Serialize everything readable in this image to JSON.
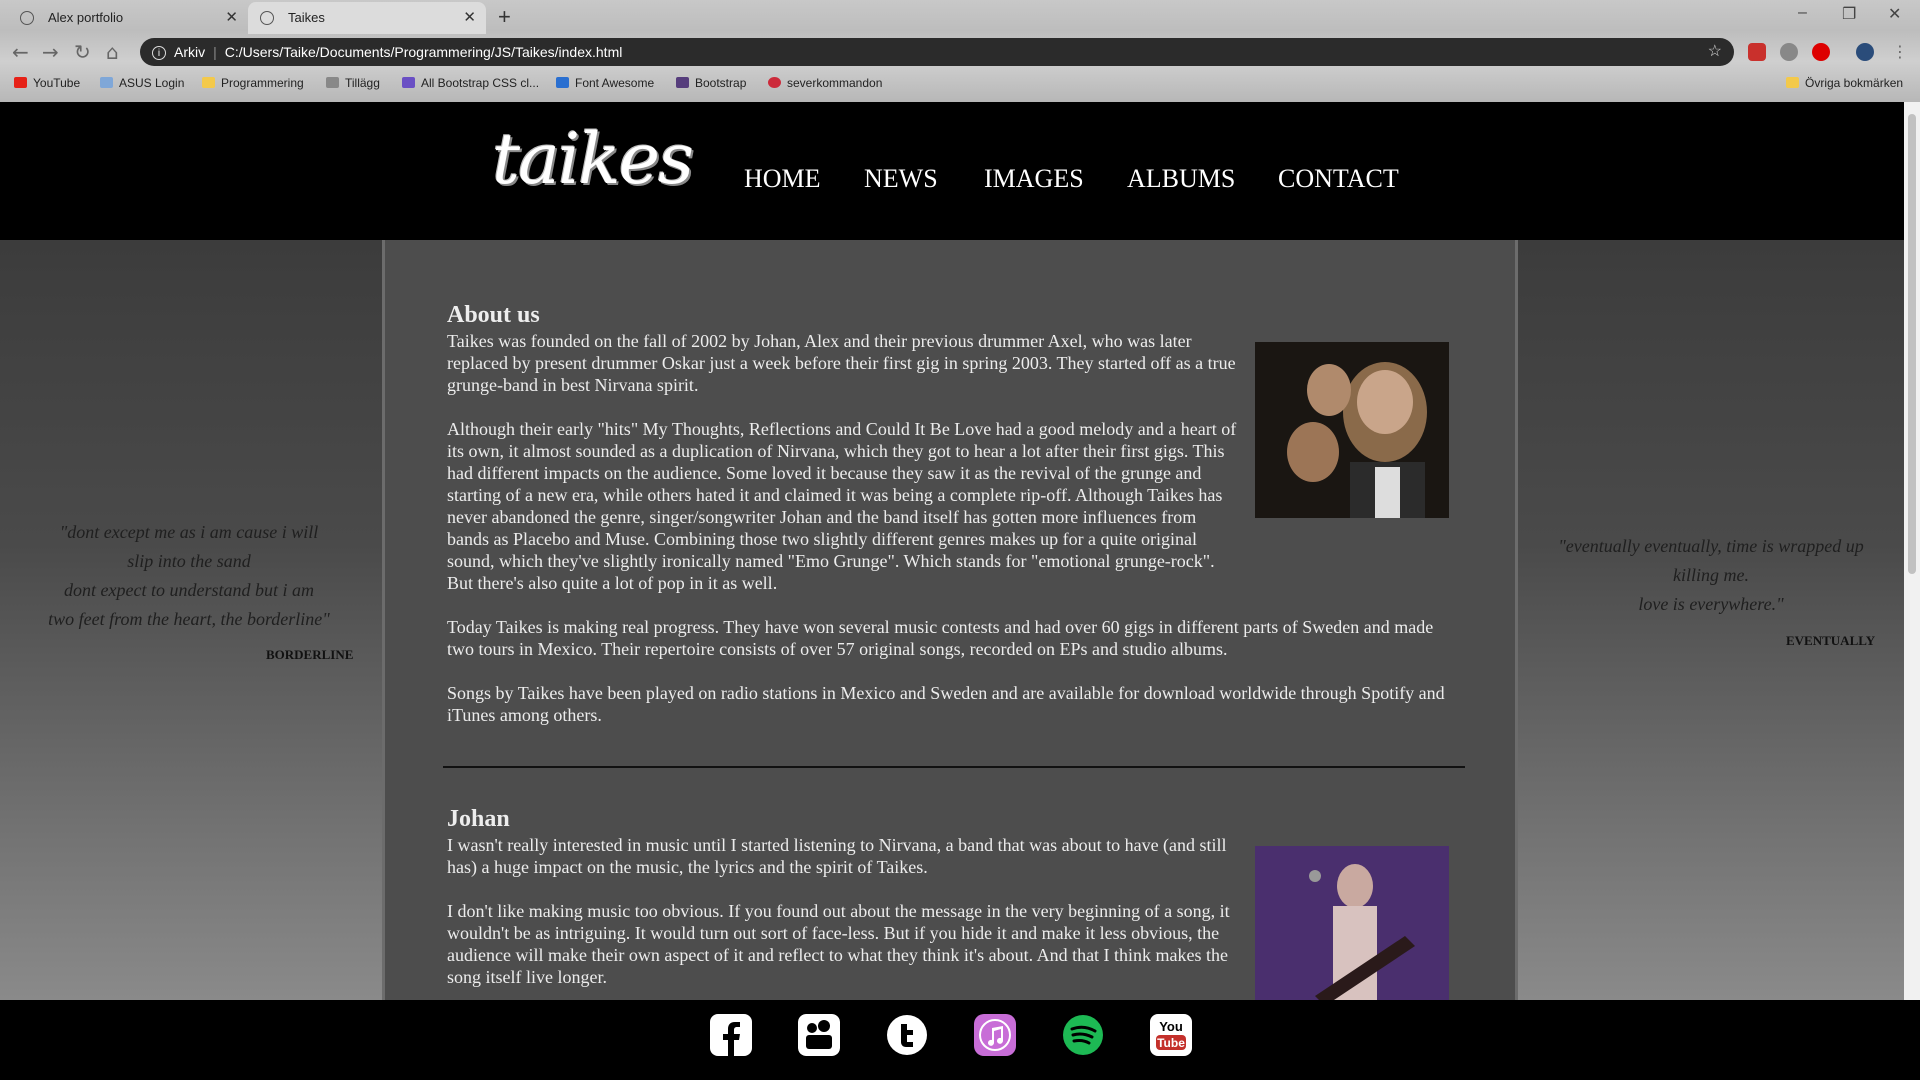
{
  "browser": {
    "tabs": [
      {
        "label": "Alex portfolio"
      },
      {
        "label": "Taikes"
      }
    ],
    "address": {
      "scheme": "Arkiv",
      "url": "C:/Users/Taike/Documents/Programmering/JS/Taikes/index.html"
    },
    "bookmarks": [
      {
        "label": "YouTube",
        "color": "#e62117"
      },
      {
        "label": "ASUS Login",
        "color": "#7fa7d8"
      },
      {
        "label": "Programmering",
        "color": "#f3c94b"
      },
      {
        "label": "Tillägg",
        "color": "#888888"
      },
      {
        "label": "All Bootstrap CSS cl...",
        "color": "#6a4fc4"
      },
      {
        "label": "Font Awesome",
        "color": "#2a6fd0"
      },
      {
        "label": "Bootstrap",
        "color": "#563d7c"
      },
      {
        "label": "severkommandon",
        "color": "#cc2a3a"
      }
    ],
    "other_bookmarks": "Övriga bokmärken"
  },
  "site": {
    "logo": "taikes",
    "nav": [
      "HOME",
      "NEWS",
      "IMAGES",
      "ALBUMS",
      "CONTACT"
    ],
    "left_quote": {
      "lines": [
        "\"dont except me as i am cause i will",
        "slip into the sand",
        "dont expect to understand but i am",
        "two feet from the heart, the borderline\""
      ],
      "title": "BORDERLINE"
    },
    "right_quote": {
      "lines": [
        "\"eventually eventually, time is wrapped up",
        "killing me.",
        "love is everywhere.\""
      ],
      "title": "EVENTUALLY"
    },
    "about": {
      "title": "About us",
      "p1": "Taikes was founded on the fall of 2002 by Johan, Alex and their previous drummer Axel, who was later replaced by present drummer Oskar just a week before their first gig in spring 2003. They started off as a true grunge-band in best Nirvana spirit.",
      "p2": "Although their early \"hits\" My Thoughts, Reflections and Could It Be Love had a good melody and a heart of its own, it almost sounded as a duplication of Nirvana, which they got to hear a lot after their first gigs. This had different impacts on the audience. Some loved it because they saw it as the revival of the grunge and starting of a new era, while others hated it and claimed it was being a complete rip-off. Although Taikes has never abandoned the genre, singer/songwriter Johan and the band itself has gotten more influences from bands as Placebo and Muse. Combining those two slightly different genres makes up for a quite original sound, which they've slightly ironically named \"Emo Grunge\". Which stands for \"emotional grunge-rock\". But there's also quite a lot of pop in it as well.",
      "p3": "Today Taikes is making real progress. They have won several music contests and had over 60 gigs in different parts of Sweden and made two tours in Mexico. Their repertoire consists of over 57 original songs, recorded on EPs and studio albums.",
      "p4": "Songs by Taikes have been played on radio stations in Mexico and Sweden and are available for download worldwide through Spotify and iTunes among others."
    },
    "johan": {
      "title": "Johan",
      "p1": "I wasn't really interested in music until I started listening to Nirvana, a band that was about to have (and still has) a huge impact on the music, the lyrics and the spirit of Taikes.",
      "p2": "I don't like making music too obvious. If you found out about the message in the very beginning of a song, it wouldn't be as intriguing. It would turn out sort of face-less. But if you hide it and make it less obvious, the audience will make their own aspect of it and reflect to what they think it's about. And that I think makes the song itself live longer."
    },
    "social": [
      {
        "name": "facebook-icon",
        "color": "#ffffff"
      },
      {
        "name": "myspace-icon",
        "color": "#ffffff"
      },
      {
        "name": "twitter-icon",
        "color": "#ffffff"
      },
      {
        "name": "itunes-icon",
        "color": "#c86dd7"
      },
      {
        "name": "spotify-icon",
        "color": "#1db954"
      },
      {
        "name": "youtube-icon",
        "color": "#ffffff"
      }
    ]
  }
}
